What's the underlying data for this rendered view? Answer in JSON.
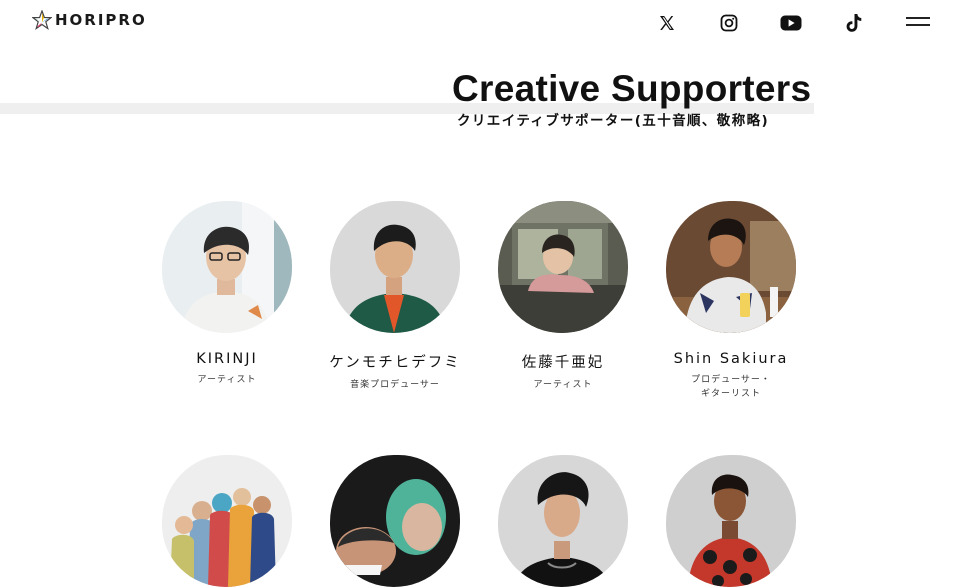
{
  "header": {
    "logo_text": "HORIPRO",
    "social": [
      {
        "icon": "x-icon"
      },
      {
        "icon": "instagram-icon"
      },
      {
        "icon": "youtube-icon"
      },
      {
        "icon": "tiktok-icon"
      }
    ],
    "menu_icon": "hamburger-menu-icon"
  },
  "section": {
    "title": "Creative Supporters",
    "subtitle": "クリエイティブサポーター(五十音順、敬称略)"
  },
  "supporters": [
    {
      "name": "KIRINJI",
      "role_line1": "アーティスト",
      "role_line2": ""
    },
    {
      "name": "ケンモチヒデフミ",
      "role_line1": "音楽プロデューサー",
      "role_line2": ""
    },
    {
      "name": "佐藤千亜妃",
      "role_line1": "アーティスト",
      "role_line2": ""
    },
    {
      "name": "Shin Sakiura",
      "role_line1": "プロデューサー・",
      "role_line2": "ギターリスト"
    },
    {
      "name": "",
      "role_line1": "",
      "role_line2": ""
    },
    {
      "name": "",
      "role_line1": "",
      "role_line2": ""
    },
    {
      "name": "",
      "role_line1": "",
      "role_line2": ""
    },
    {
      "name": "",
      "role_line1": "",
      "role_line2": ""
    }
  ],
  "colors": {
    "text": "#111111",
    "title_bar": "#efefef",
    "background": "#ffffff"
  }
}
